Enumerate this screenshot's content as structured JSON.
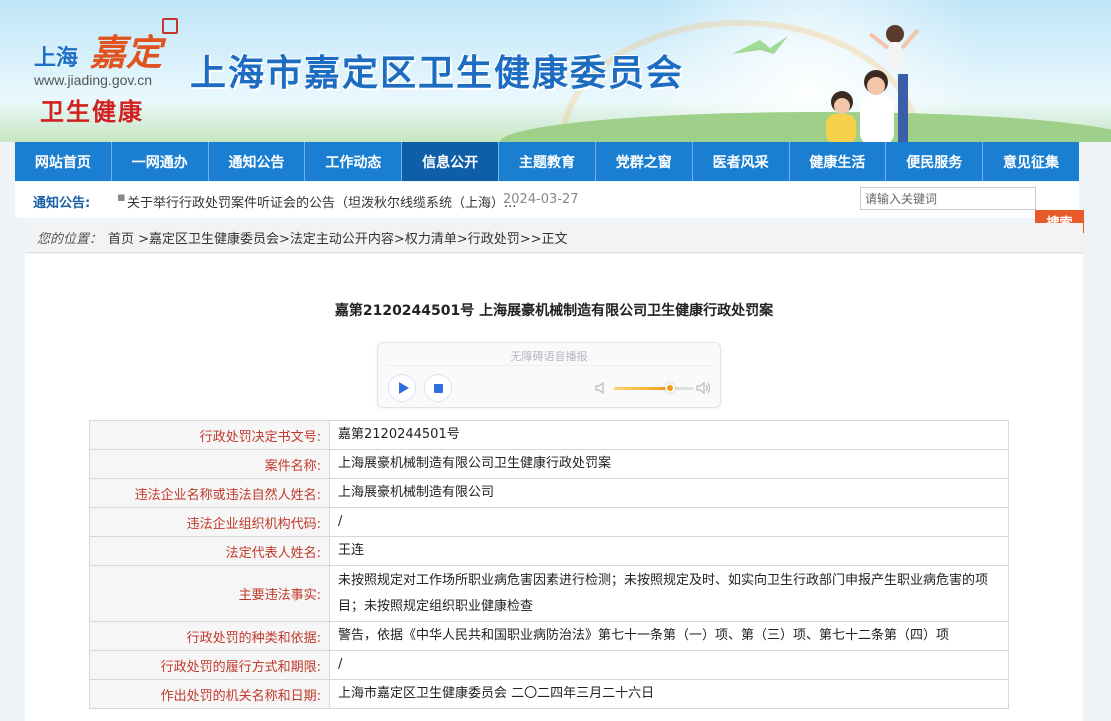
{
  "header": {
    "logo_shanghai": "上海",
    "logo_jiading": "嘉定",
    "logo_url": "www.jiading.gov.cn",
    "logo_health": "卫生健康",
    "site_title": "上海市嘉定区卫生健康委员会"
  },
  "nav": {
    "items": [
      {
        "label": "网站首页"
      },
      {
        "label": "一网通办"
      },
      {
        "label": "通知公告"
      },
      {
        "label": "工作动态"
      },
      {
        "label": "信息公开",
        "active": true
      },
      {
        "label": "主题教育"
      },
      {
        "label": "党群之窗"
      },
      {
        "label": "医者风采"
      },
      {
        "label": "健康生活"
      },
      {
        "label": "便民服务"
      },
      {
        "label": "意见征集"
      }
    ]
  },
  "notice": {
    "label": "通知公告:",
    "bullet": "▪",
    "text": "关于举行行政处罚案件听证会的公告（坦泼秋尔线缆系统（上海）...",
    "date": "2024-03-27"
  },
  "search": {
    "placeholder": "请输入关键词",
    "button_label": "搜索"
  },
  "breadcrumb": {
    "label": "您的位置：",
    "path": "首页 >嘉定区卫生健康委员会>法定主动公开内容>权力清单>行政处罚>>正文"
  },
  "article": {
    "title": "嘉第2120244501号 上海展豪机械制造有限公司卫生健康行政处罚案"
  },
  "player": {
    "caption": "无障碍语音播报",
    "volume_percent": 70
  },
  "table": {
    "rows": [
      {
        "key": "行政处罚决定书文号:",
        "value": "嘉第2120244501号"
      },
      {
        "key": "案件名称:",
        "value": "上海展豪机械制造有限公司卫生健康行政处罚案"
      },
      {
        "key": "违法企业名称或违法自然人姓名:",
        "value": "上海展豪机械制造有限公司"
      },
      {
        "key": "违法企业组织机构代码:",
        "value": "/"
      },
      {
        "key": "法定代表人姓名:",
        "value": "王连"
      },
      {
        "key": "主要违法事实:",
        "value": "未按照规定对工作场所职业病危害因素进行检测；未按照规定及时、如实向卫生行政部门申报产生职业病危害的项目；未按照规定组织职业健康检查",
        "tall": true
      },
      {
        "key": "行政处罚的种类和依据:",
        "value": "警告，依据《中华人民共和国职业病防治法》第七十一条第（一）项、第（三）项、第七十二条第（四）项"
      },
      {
        "key": "行政处罚的履行方式和期限:",
        "value": "/"
      },
      {
        "key": "作出处罚的机关名称和日期:",
        "value": "上海市嘉定区卫生健康委员会 二〇二四年三月二十六日"
      }
    ]
  }
}
